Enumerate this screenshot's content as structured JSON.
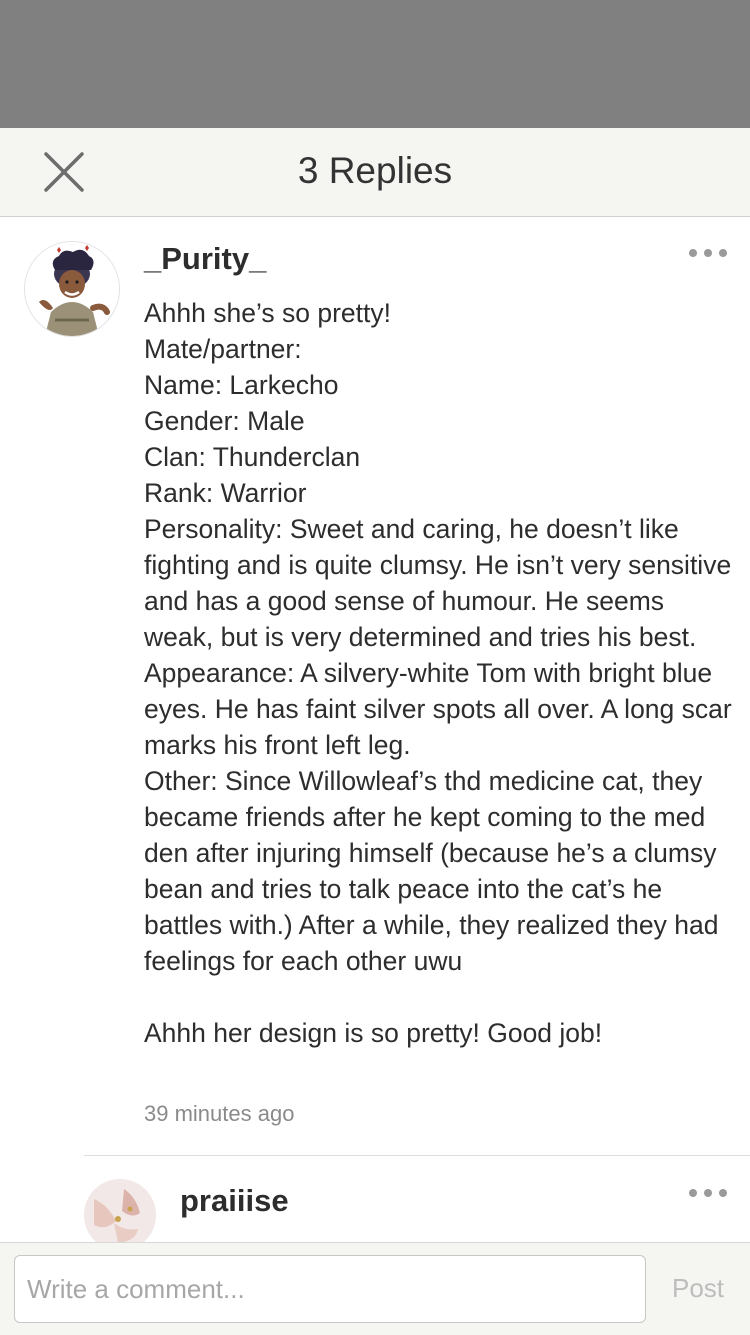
{
  "header": {
    "title": "3 Replies",
    "close_icon": "close-icon"
  },
  "comment": {
    "username": "_Purity_",
    "more_icon": "more-dots-icon",
    "lines": [
      "Ahhh she’s so pretty!",
      "Mate/partner:",
      "Name: Larkecho",
      "Gender: Male",
      "Clan: Thunderclan",
      "Rank: Warrior",
      "Personality: Sweet and caring, he doesn’t like fighting and is quite clumsy. He isn’t very sensitive and has a good sense of humour. He seems weak, but is very determined and tries his best.",
      "Appearance: A silvery-white Tom with bright blue eyes. He has faint silver spots all over. A long scar marks his front left leg.",
      "Other: Since Willowleaf’s thd medicine cat, they became friends after he kept coming to the med den after injuring himself (because he’s a clumsy bean and tries to talk peace into the cat’s he battles with.) After a while, they realized they had feelings for each other uwu",
      "Ahhh her design is so pretty! Good job!"
    ],
    "timestamp": "39 minutes ago"
  },
  "reply": {
    "username": "praiiise",
    "more_icon": "more-dots-icon"
  },
  "composer": {
    "placeholder": "Write a comment...",
    "value": "",
    "post_label": "Post"
  },
  "colors": {
    "overlay": "#808080",
    "header_bg": "#f5f5f2",
    "text": "#2d2d2d",
    "muted": "#8a8a8a",
    "post_disabled": "#bdbdbd"
  }
}
